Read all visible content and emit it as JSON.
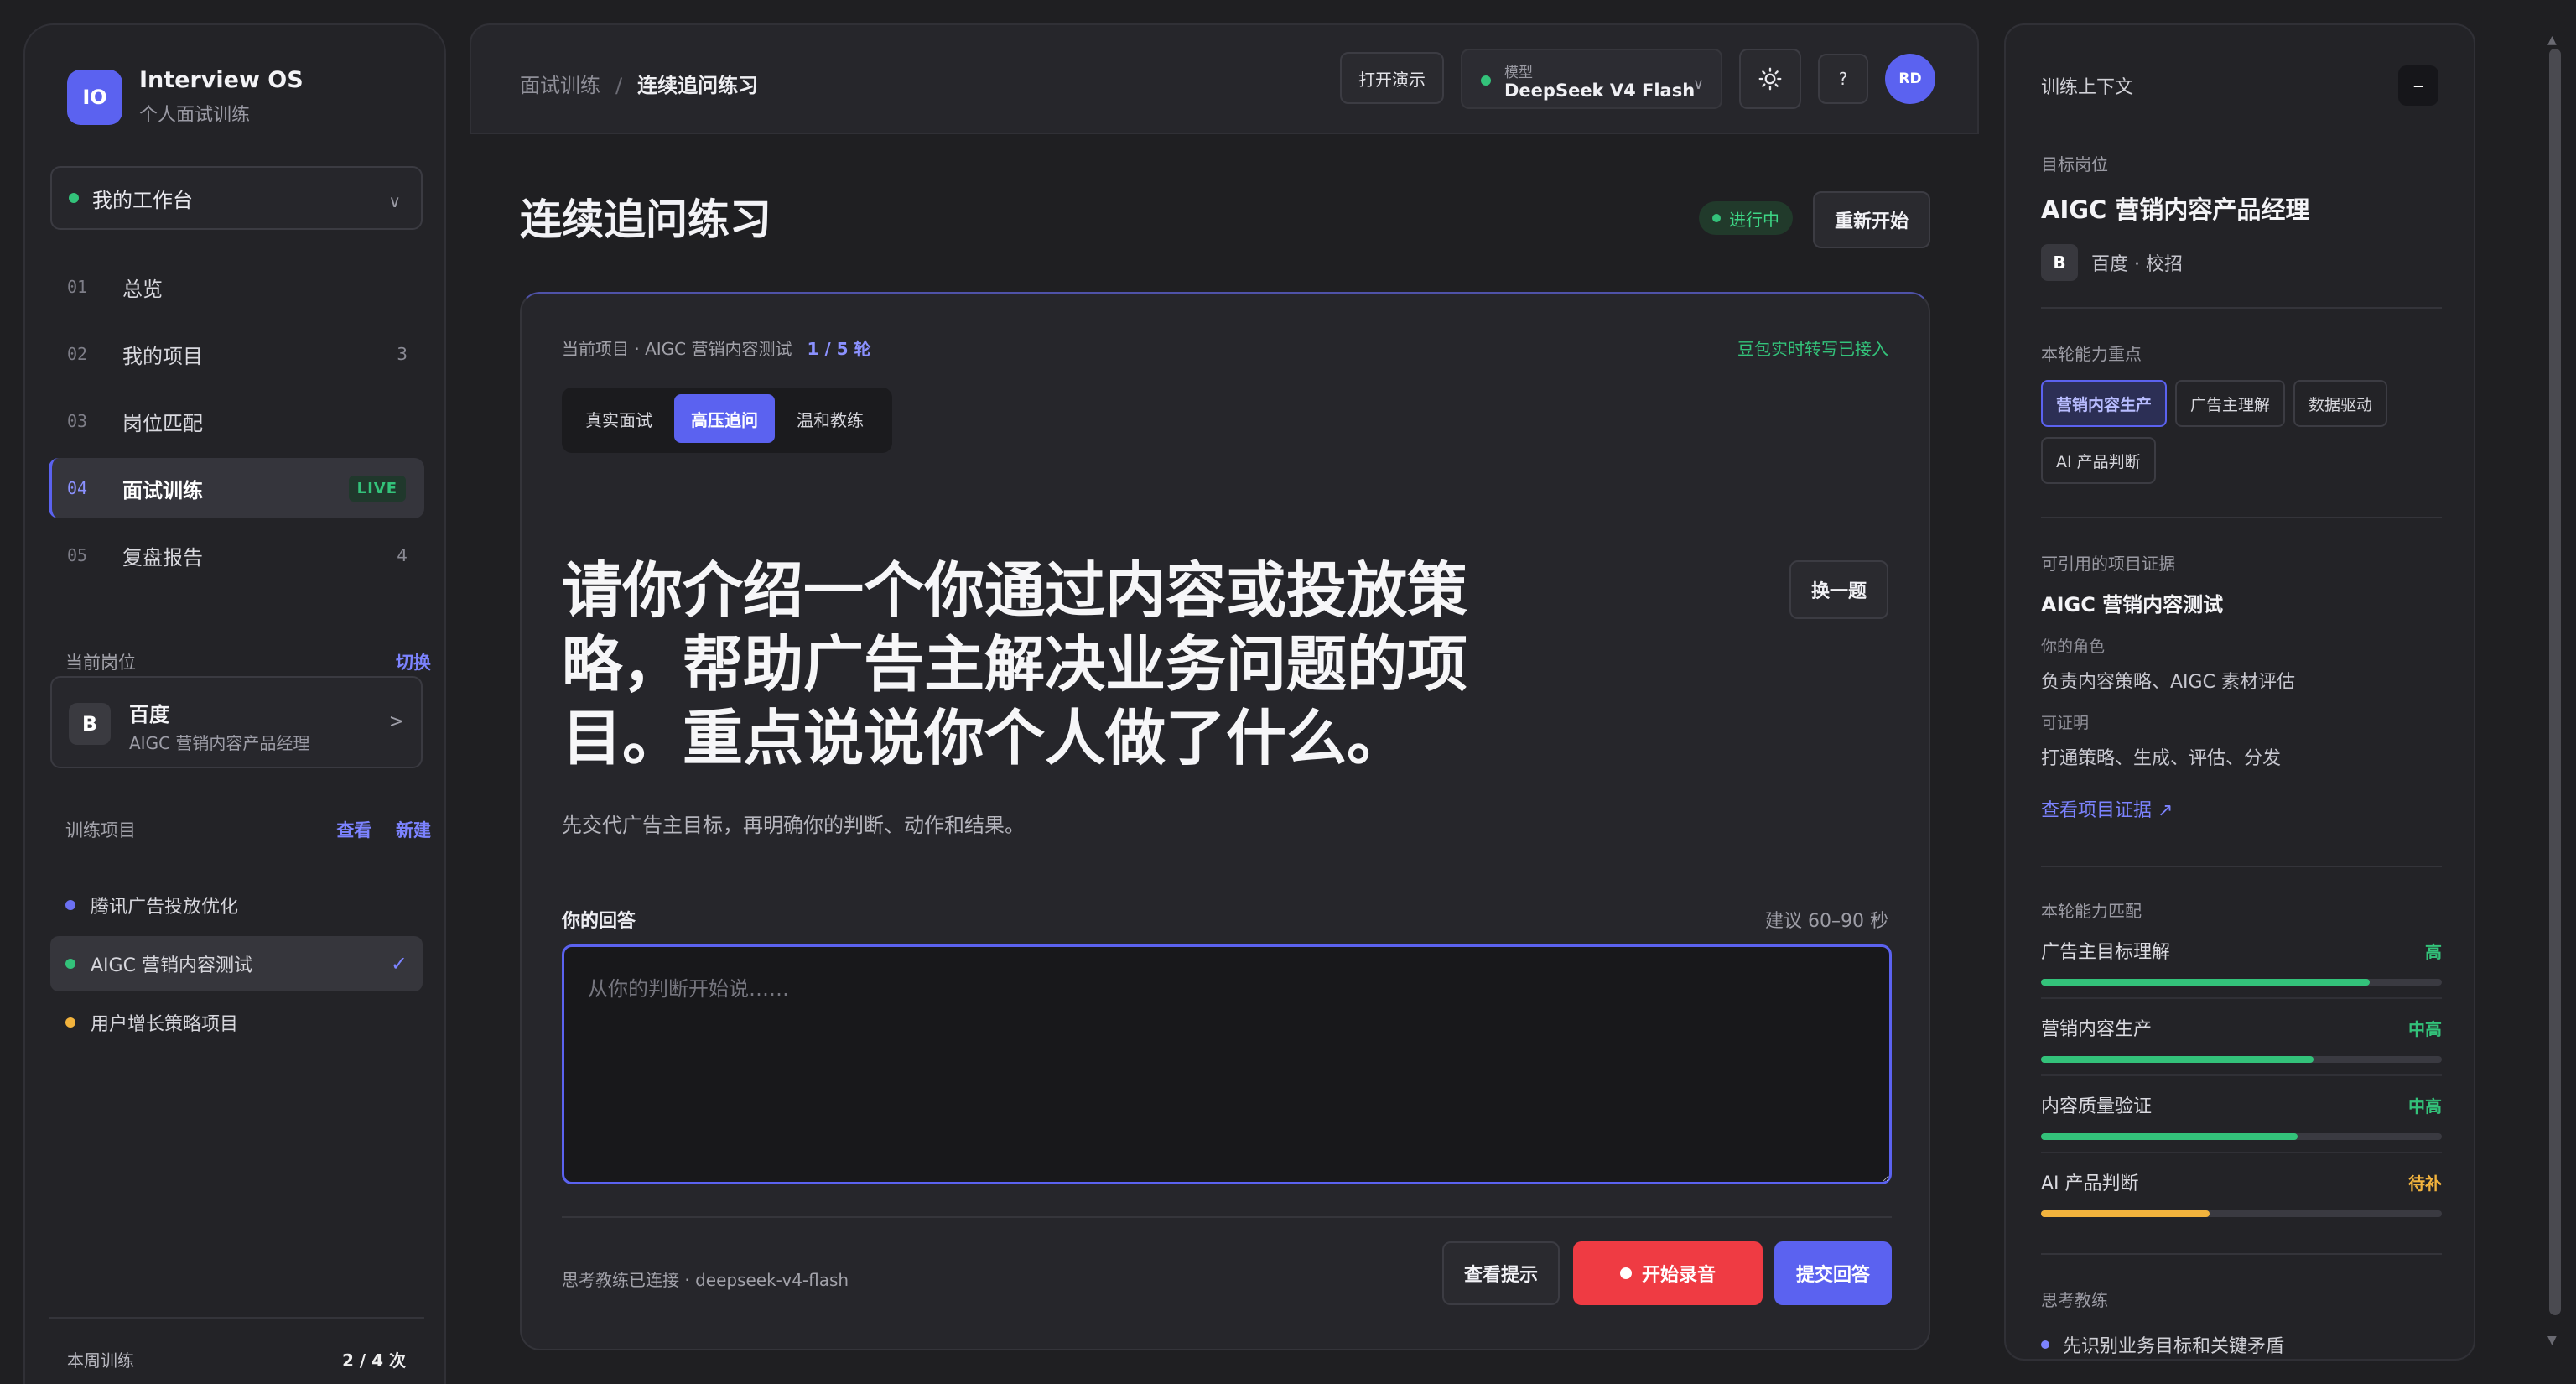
{
  "app": {
    "name": "Interview OS",
    "subtitle": "个人面试训练",
    "logo": "IO"
  },
  "workspace": {
    "label": "我的工作台"
  },
  "nav": [
    {
      "num": "01",
      "label": "总览",
      "count": ""
    },
    {
      "num": "02",
      "label": "我的项目",
      "count": "3"
    },
    {
      "num": "03",
      "label": "岗位匹配",
      "count": ""
    },
    {
      "num": "04",
      "label": "面试训练",
      "count": "",
      "badge": "LIVE",
      "active": true
    },
    {
      "num": "05",
      "label": "复盘报告",
      "count": "4"
    }
  ],
  "current_role": {
    "heading": "当前岗位",
    "switch": "切换",
    "badge": "B",
    "company": "百度",
    "title": "AIGC 营销内容产品经理"
  },
  "projects": {
    "heading": "训练项目",
    "view": "查看",
    "new": "新建",
    "items": [
      {
        "label": "腾讯广告投放优化",
        "color": "#6b70f2"
      },
      {
        "label": "AIGC 营销内容测试",
        "color": "#33c27a",
        "active": true
      },
      {
        "label": "用户增长策略项目",
        "color": "#f2b33d"
      }
    ]
  },
  "weekly": {
    "label": "本周训练",
    "value": "2 / 4 次",
    "progress": 0.5
  },
  "topbar": {
    "crumb_parent": "面试训练",
    "crumb_sep": "/",
    "crumb_current": "连续追问练习",
    "demo_btn": "打开演示",
    "model_key": "模型",
    "model_value": "DeepSeek V4 Flash",
    "help": "?",
    "avatar": "RD"
  },
  "main": {
    "title": "连续追问练习",
    "status": "进行中",
    "restart": "重新开始",
    "meta": "当前项目 · AIGC 营销内容测试",
    "round": "1 / 5 轮",
    "connected": "豆包实时转写已接入",
    "modes": [
      {
        "label": "真实面试"
      },
      {
        "label": "高压追问",
        "on": true
      },
      {
        "label": "温和教练"
      }
    ],
    "question": "请你介绍一个你通过内容或投放策略，帮助广告主解决业务问题的项目。重点说说你个人做了什么。",
    "swap": "换一题",
    "hint": "先交代广告主目标，再明确你的判断、动作和结果。",
    "answer_label": "你的回答",
    "answer_time": "建议 60–90 秒",
    "answer_placeholder": "从你的判断开始说……",
    "footer_status": "思考教练已连接 · deepseek-v4-flash",
    "btn_hint": "查看提示",
    "btn_record": "开始录音",
    "btn_submit": "提交回答"
  },
  "context": {
    "heading": "训练上下文",
    "collapse": "–",
    "target_label": "目标岗位",
    "target_title": "AIGC 营销内容产品经理",
    "company_badge": "B",
    "company": "百度 · 校招",
    "focus_label": "本轮能力重点",
    "focus_tags": [
      {
        "label": "营销内容生产",
        "on": true
      },
      {
        "label": "广告主理解"
      },
      {
        "label": "数据驱动"
      },
      {
        "label": "AI 产品判断"
      }
    ],
    "evidence_label": "可引用的项目证据",
    "evidence_name": "AIGC 营销内容测试",
    "role_label": "你的角色",
    "role_value": "负责内容策略、AIGC 素材评估",
    "proof_label": "可证明",
    "proof_value": "打通策略、生成、评估、分发",
    "evidence_link": "查看项目证据 ↗",
    "match_label": "本轮能力匹配",
    "matches": [
      {
        "name": "广告主目标理解",
        "level": "高",
        "value": 0.82,
        "color": "#33c27a"
      },
      {
        "name": "营销内容生产",
        "level": "中高",
        "value": 0.68,
        "color": "#33c27a"
      },
      {
        "name": "内容质量验证",
        "level": "中高",
        "value": 0.64,
        "color": "#33c27a"
      },
      {
        "name": "AI 产品判断",
        "level": "待补",
        "value": 0.42,
        "color": "#f2b33d"
      }
    ],
    "coach_label": "思考教练",
    "coach_items": [
      "先识别业务目标和关键矛盾"
    ]
  }
}
